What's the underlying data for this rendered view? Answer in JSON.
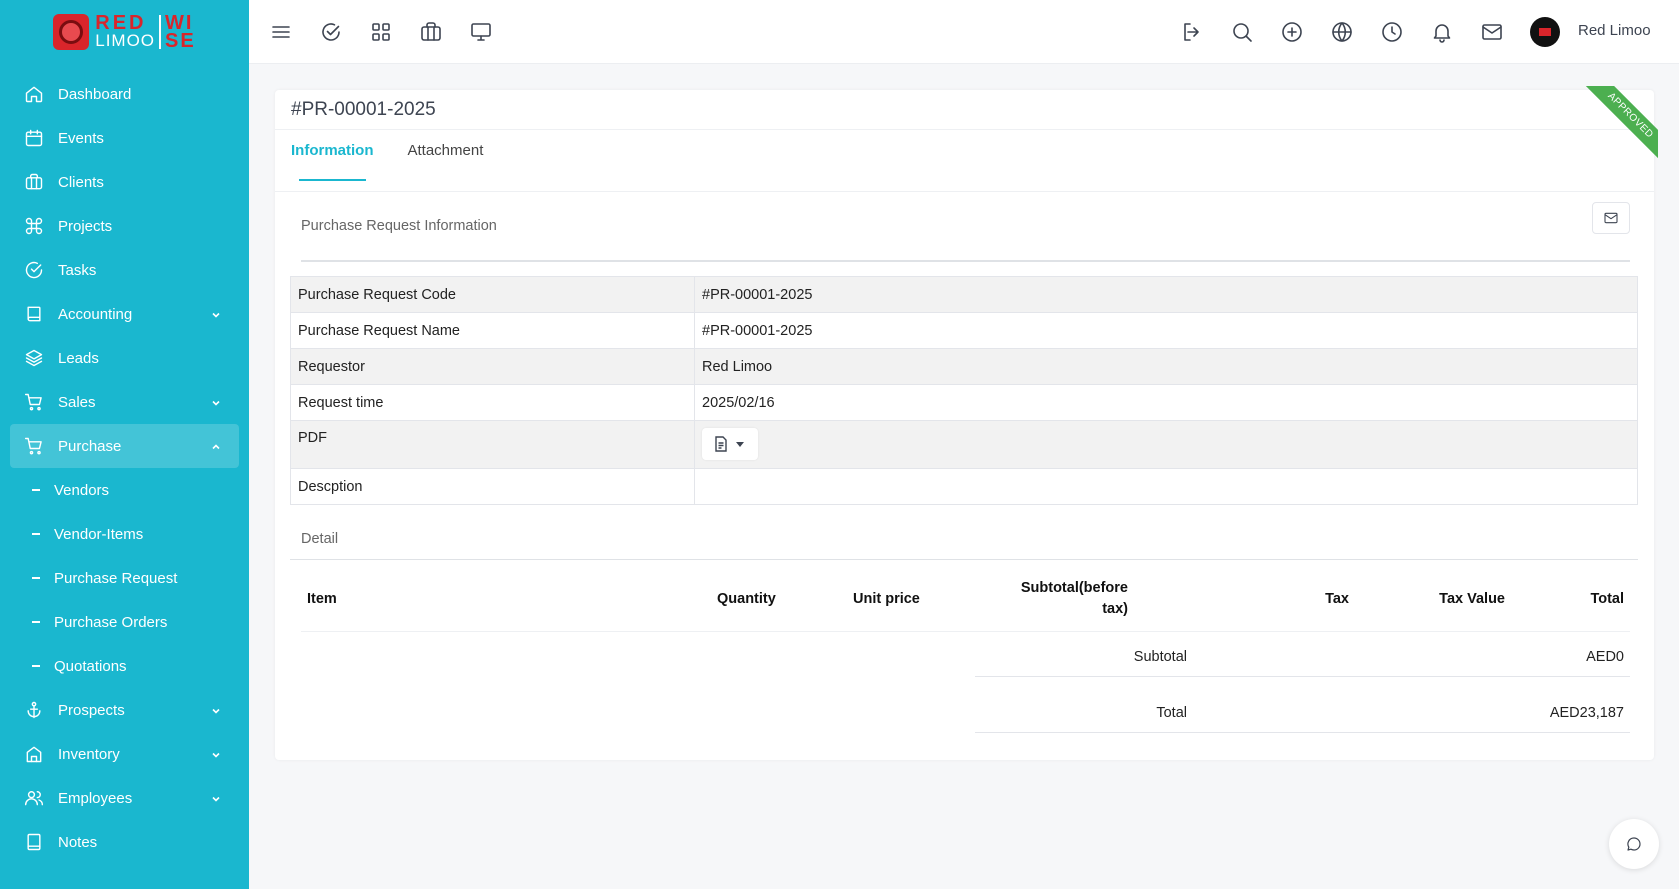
{
  "logo": {
    "red": "RED",
    "limoo": "LIMOO",
    "wi": "WI",
    "se": "SE"
  },
  "sidebar": {
    "items": [
      {
        "label": "Dashboard",
        "icon": "home-icon"
      },
      {
        "label": "Events",
        "icon": "calendar-icon"
      },
      {
        "label": "Clients",
        "icon": "briefcase-icon"
      },
      {
        "label": "Projects",
        "icon": "command-icon"
      },
      {
        "label": "Tasks",
        "icon": "check-circle-icon"
      },
      {
        "label": "Accounting",
        "icon": "book-icon"
      },
      {
        "label": "Leads",
        "icon": "layers-icon"
      },
      {
        "label": "Sales",
        "icon": "cart-icon"
      },
      {
        "label": "Purchase",
        "icon": "cart-icon"
      },
      {
        "label": "Prospects",
        "icon": "anchor-icon"
      },
      {
        "label": "Inventory",
        "icon": "house-icon"
      },
      {
        "label": "Employees",
        "icon": "users-icon"
      },
      {
        "label": "Notes",
        "icon": "notebook-icon"
      }
    ],
    "purchase_sub": [
      "Vendors",
      "Vendor-Items",
      "Purchase Request",
      "Purchase Orders",
      "Quotations"
    ]
  },
  "topbar": {
    "user_name": "Red Limoo"
  },
  "card": {
    "title": "#PR-00001-2025",
    "status_ribbon": "APPROVED",
    "tabs": [
      "Information",
      "Attachment"
    ],
    "section_title": "Purchase Request Information",
    "info_rows": [
      {
        "label": "Purchase Request Code",
        "value": "#PR-00001-2025"
      },
      {
        "label": "Purchase Request Name",
        "value": "#PR-00001-2025"
      },
      {
        "label": "Requestor",
        "value": "Red Limoo"
      },
      {
        "label": "Request time",
        "value": "2025/02/16"
      },
      {
        "label": "PDF",
        "value": ""
      },
      {
        "label": "Descption",
        "value": ""
      }
    ],
    "detail": {
      "title": "Detail",
      "columns": {
        "item": "Item",
        "quantity": "Quantity",
        "unit_price": "Unit price",
        "subtotal_1": "Subtotal(before",
        "subtotal_2": "tax)",
        "tax": "Tax",
        "tax_value": "Tax Value",
        "total": "Total"
      },
      "subtotal_label": "Subtotal",
      "subtotal_value": "AED0",
      "total_label": "Total",
      "total_value": "AED23,187"
    }
  },
  "colors": {
    "sidebar": "#1ab7cf",
    "accent": "#1ab7cf",
    "ribbon": "#4caf50",
    "brand_red": "#d9252b"
  }
}
